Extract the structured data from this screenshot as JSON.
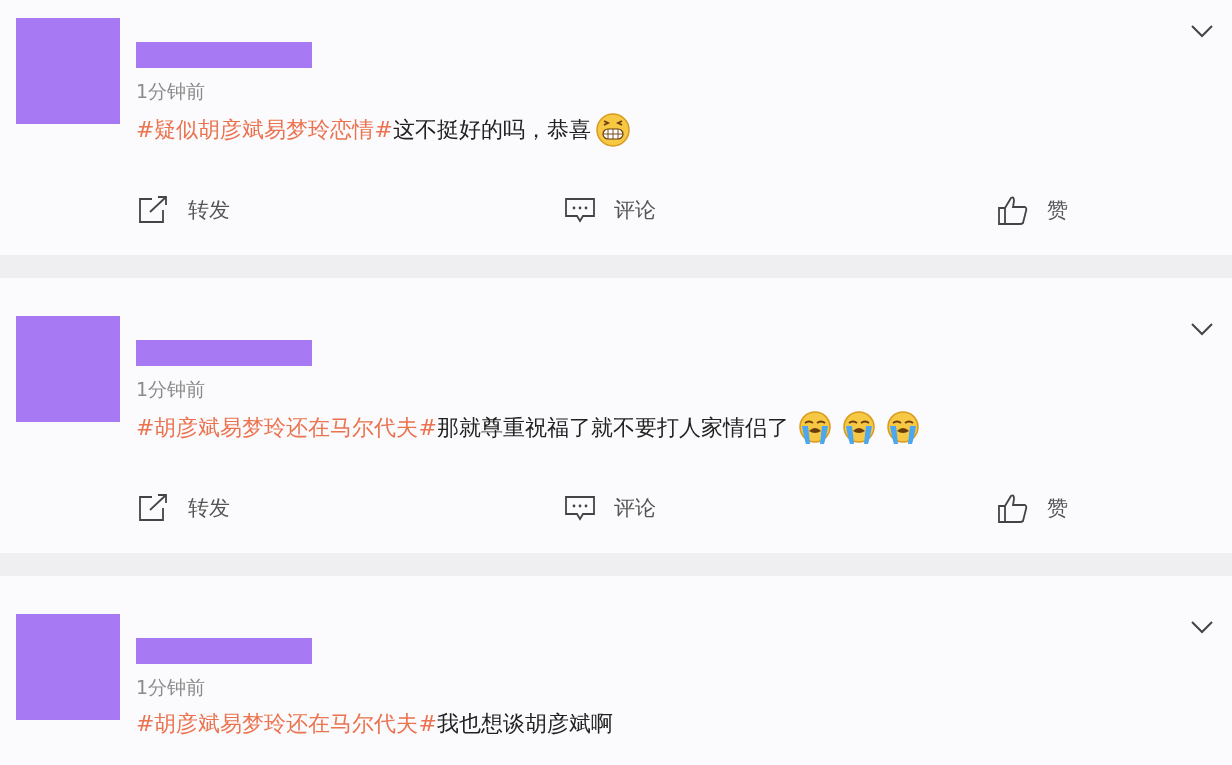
{
  "posts": [
    {
      "time": "1分钟前",
      "hashtag": "#疑似胡彦斌易梦玲恋情#",
      "text": "这不挺好的吗，恭喜",
      "emojis": [
        {
          "kind": "grin"
        }
      ],
      "actions": {
        "repost": "转发",
        "comment": "评论",
        "like": "赞"
      }
    },
    {
      "time": "1分钟前",
      "hashtag": "#胡彦斌易梦玲还在马尔代夫#",
      "text": "那就尊重祝福了就不要打人家情侣了",
      "emojis": [
        {
          "kind": "cry"
        },
        {
          "kind": "cry"
        },
        {
          "kind": "cry"
        }
      ],
      "actions": {
        "repost": "转发",
        "comment": "评论",
        "like": "赞"
      }
    },
    {
      "time": "1分钟前",
      "hashtag": "#胡彦斌易梦玲还在马尔代夫#",
      "text": "我也想谈胡彦斌啊"
    }
  ]
}
